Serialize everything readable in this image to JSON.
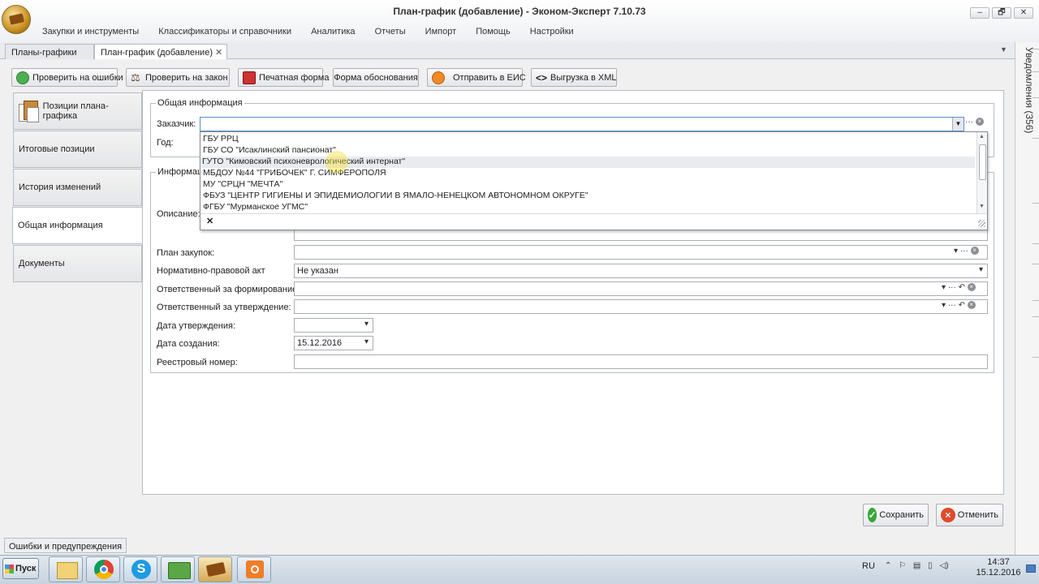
{
  "window": {
    "title": "План-график (добавление) - Эконом-Эксперт 7.10.73",
    "min": "–",
    "max": "🗗",
    "close": "✕"
  },
  "menu": [
    "Закупки и инструменты",
    "Классификаторы и справочники",
    "Аналитика",
    "Отчеты",
    "Импорт",
    "Помощь",
    "Настройки"
  ],
  "tabs": [
    {
      "label": "Планы-графики"
    },
    {
      "label": "План-график (добавление)",
      "close": "✕"
    }
  ],
  "notifications_label": "Уведомления (356)",
  "toolbar": {
    "check_errors": "Проверить на ошибки",
    "check_law": "Проверить на закон",
    "print_form": "Печатная форма",
    "justification_form": "Форма обоснования",
    "send_eis": "Отправить в ЕИС",
    "export_xml": "Выгрузка в XML"
  },
  "nav": [
    "Позиции плана-графика",
    "Итоговые позиции",
    "История изменений",
    "Общая информация",
    "Документы"
  ],
  "form": {
    "general_legend": "Общая информация",
    "customer_label": "Заказчик:",
    "year_label": "Год:",
    "info_legend": "Информация",
    "description_label": "Описание:",
    "purchase_plan_label": "План закупок:",
    "legal_act_label": "Нормативно-правовой акт",
    "legal_act_value": "Не указан",
    "responsible_forming_label": "Ответственный за формирование:",
    "responsible_approval_label": "Ответственный за утверждение:",
    "approval_date_label": "Дата утверждения:",
    "creation_date_label": "Дата создания:",
    "creation_date_value": "15.12.2016",
    "registry_number_label": "Реестровый номер:"
  },
  "dropdown": {
    "items": [
      "ГБУ РРЦ",
      "ГБУ СО \"Исаклинский пансионат\"",
      "ГУТО \"Кимовский психоневрологический интернат\"",
      "МБДОУ №44 \"ГРИБОЧЕК\" Г. СИМФЕРОПОЛЯ",
      "МУ \"СРЦН \"МЕЧТА\"",
      "ФБУЗ \"ЦЕНТР ГИГИЕНЫ И ЭПИДЕМИОЛОГИИ В ЯМАЛО-НЕНЕЦКОМ АВТОНОМНОМ ОКРУГЕ\"",
      "ФГБУ \"Мурманское УГМС\""
    ],
    "highlighted_index": 2,
    "clear_glyph": "✕"
  },
  "buttons": {
    "save": "Сохранить",
    "cancel": "Отменить"
  },
  "bottom_tab": "Ошибки и предупреждения",
  "taskbar": {
    "start": "Пуск",
    "lang": "RU",
    "time": "14:37",
    "date": "15.12.2016"
  },
  "colors": {
    "accent_green": "#3aa63a",
    "cancel_red": "#e04a2a",
    "highlight": "#e9ecef"
  }
}
